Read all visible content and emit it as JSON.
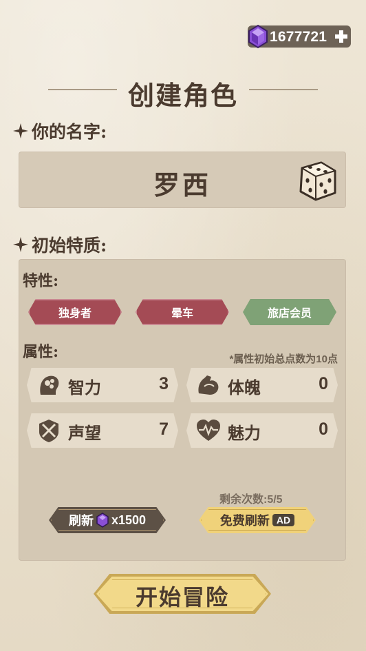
{
  "currency": {
    "amount": "1677721",
    "icon": "purple-gem-icon",
    "add_icon": "plus-icon"
  },
  "title": "创建角色",
  "name_section": {
    "label": "你的名字:",
    "name": "罗西",
    "dice_icon": "dice-icon"
  },
  "traits_section": {
    "label": "初始特质:",
    "traits_label": "特性:",
    "traits": [
      {
        "label": "独身者",
        "color": "#a44b55"
      },
      {
        "label": "晕车",
        "color": "#a44b55"
      },
      {
        "label": "旅店会员",
        "color": "#7fa276"
      }
    ],
    "attributes_label": "属性:",
    "attributes_note": "*属性初始总点数为10点",
    "attributes": [
      {
        "name": "智力",
        "value": "3",
        "icon": "brain-head-icon"
      },
      {
        "name": "体魄",
        "value": "0",
        "icon": "muscle-arm-icon"
      },
      {
        "name": "声望",
        "value": "7",
        "icon": "crossed-swords-icon"
      },
      {
        "name": "魅力",
        "value": "0",
        "icon": "heart-pulse-icon"
      }
    ],
    "remaining_label": "剩余次数:5/5",
    "refresh_button": {
      "label": "刷新",
      "cost": "x1500"
    },
    "free_refresh_button": {
      "label": "免费刷新",
      "badge": "AD"
    }
  },
  "start_button": {
    "label": "开始冒险"
  }
}
